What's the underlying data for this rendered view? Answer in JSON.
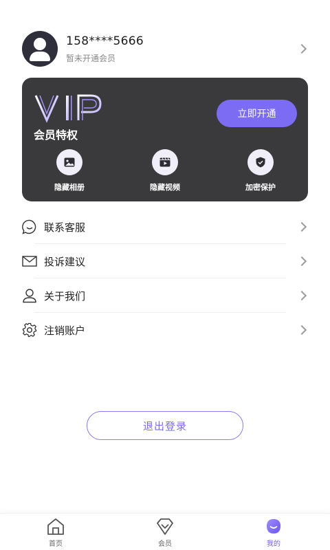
{
  "profile": {
    "phone": "158****5666",
    "status": "暂未开通会员"
  },
  "vip": {
    "logo_text": "VIP",
    "title": "会员特权",
    "open_button": "立即开通",
    "perks": [
      {
        "label": "隐藏相册",
        "icon": "album-icon"
      },
      {
        "label": "隐藏视频",
        "icon": "video-icon"
      },
      {
        "label": "加密保护",
        "icon": "shield-icon"
      }
    ],
    "accent_color": "#7c6cf3",
    "card_color": "#3a393b"
  },
  "menu": {
    "items": [
      {
        "label": "联系客服",
        "icon": "chat-icon"
      },
      {
        "label": "投诉建议",
        "icon": "mail-icon"
      },
      {
        "label": "关于我们",
        "icon": "person-icon"
      },
      {
        "label": "注销账户",
        "icon": "settings-icon"
      }
    ]
  },
  "logout_label": "退出登录",
  "tabbar": {
    "tabs": [
      {
        "label": "首页",
        "icon": "home-icon",
        "active": false
      },
      {
        "label": "会员",
        "icon": "diamond-icon",
        "active": false
      },
      {
        "label": "我的",
        "icon": "profile-icon",
        "active": true
      }
    ]
  }
}
